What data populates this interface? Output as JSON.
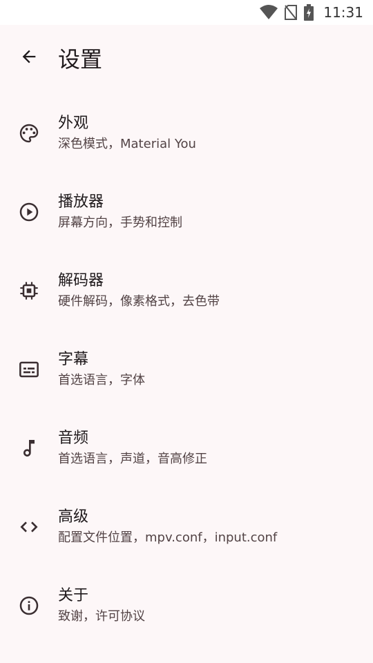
{
  "status_bar": {
    "time": "11:31",
    "icons": [
      "wifi-icon",
      "no-sim-icon",
      "battery-charging-icon"
    ]
  },
  "app_bar": {
    "back_icon": "arrow-back-icon",
    "title": "设置"
  },
  "settings": [
    {
      "icon": "palette-icon",
      "title": "外观",
      "subtitle": "深色模式，Material You"
    },
    {
      "icon": "play-circle-icon",
      "title": "播放器",
      "subtitle": "屏幕方向，手势和控制"
    },
    {
      "icon": "chip-icon",
      "title": "解码器",
      "subtitle": "硬件解码，像素格式，去色带"
    },
    {
      "icon": "subtitles-icon",
      "title": "字幕",
      "subtitle": "首选语言，字体"
    },
    {
      "icon": "music-note-icon",
      "title": "音频",
      "subtitle": "首选语言，声道，音高修正"
    },
    {
      "icon": "code-icon",
      "title": "高级",
      "subtitle": "配置文件位置，mpv.conf，input.conf"
    },
    {
      "icon": "info-icon",
      "title": "关于",
      "subtitle": "致谢，许可协议"
    }
  ],
  "colors": {
    "background": "#fdf7f8",
    "status_bar": "#ffffff",
    "text_primary": "#1f1a1c",
    "text_secondary": "#524345"
  }
}
